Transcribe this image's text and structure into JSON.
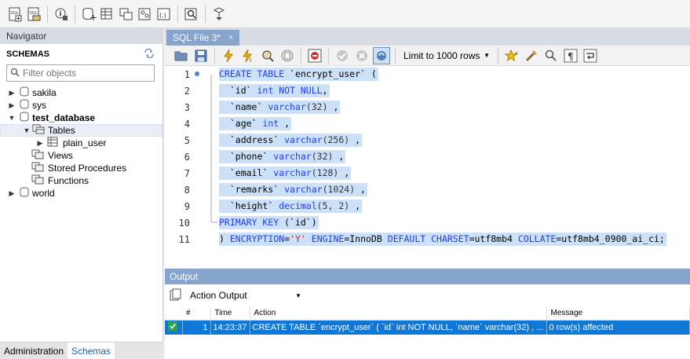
{
  "navigator": {
    "title": "Navigator",
    "schemas_label": "SCHEMAS",
    "filter_placeholder": "Filter objects",
    "tree": [
      {
        "label": "sakila"
      },
      {
        "label": "sys"
      },
      {
        "label": "test_database"
      },
      {
        "label": "Tables"
      },
      {
        "label": "plain_user"
      },
      {
        "label": "Views"
      },
      {
        "label": "Stored Procedures"
      },
      {
        "label": "Functions"
      },
      {
        "label": "world"
      }
    ],
    "bottom_tabs": [
      "Administration",
      "Schemas"
    ]
  },
  "editor": {
    "tab_label": "SQL File 3*",
    "tab_close": "×",
    "limit_label": "Limit to 1000 rows",
    "line_numbers": [
      "1",
      "2",
      "3",
      "4",
      "5",
      "6",
      "7",
      "8",
      "9",
      "10",
      "11"
    ],
    "lines": [
      {
        "pre": "",
        "kw": "CREATE TABLE",
        "rest": " `encrypt_user` ("
      },
      {
        "pre": "  ",
        "field": "`id`",
        "kw": "int NOT NULL",
        "rest": ","
      },
      {
        "pre": "  ",
        "field": "`name`",
        "kw": "varchar",
        "args": "(32)",
        "rest": " ,"
      },
      {
        "pre": "  ",
        "field": "`age`",
        "kw": "int",
        "rest": " ,"
      },
      {
        "pre": "  ",
        "field": "`address`",
        "kw": "varchar",
        "args": "(256)",
        "rest": " ,"
      },
      {
        "pre": "  ",
        "field": "`phone`",
        "kw": "varchar",
        "args": "(32)",
        "rest": " ,"
      },
      {
        "pre": "  ",
        "field": "`email`",
        "kw": "varchar",
        "args": "(128)",
        "rest": " ,"
      },
      {
        "pre": "  ",
        "field": "`remarks`",
        "kw": "varchar",
        "args": "(1024)",
        "rest": " ,"
      },
      {
        "pre": "  ",
        "field": "`height`",
        "kw": "decimal",
        "args": "(5, 2)",
        "rest": " ,"
      },
      {
        "pre": "",
        "kw": "PRIMARY KEY",
        "rest": " (`id`)"
      },
      {
        "pre": "",
        "p1": ") ",
        "kw1": "ENCRYPTION",
        "p2": "=",
        "str": "'Y'",
        "p3": " ",
        "kw2": "ENGINE",
        "p4": "=InnoDB ",
        "kw3": "DEFAULT CHARSET",
        "p5": "=utf8mb4 ",
        "kw4": "COLLATE",
        "p6": "=utf8mb4_0900_ai_ci;"
      }
    ]
  },
  "output": {
    "title": "Output",
    "selector_value": "Action Output",
    "columns": [
      "#",
      "Time",
      "Action",
      "Message"
    ],
    "rows": [
      {
        "num": "1",
        "time": "14:23:37",
        "action": "CREATE TABLE `encrypt_user` (   `id` int NOT NULL,   `name` varchar(32) , ...",
        "message": "0 row(s) affected"
      }
    ]
  }
}
